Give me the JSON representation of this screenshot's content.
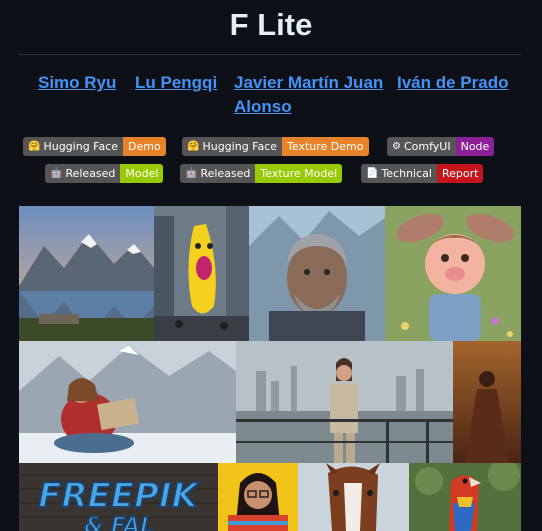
{
  "page": {
    "title": "F Lite"
  },
  "authors": [
    {
      "name": "Simo Ryu"
    },
    {
      "name": "Lu Pengqi"
    },
    {
      "name": "Javier Martín Juan"
    },
    {
      "name": "Iván de Prado"
    },
    {
      "name": "Alonso"
    }
  ],
  "badges": [
    {
      "icon": "🤗",
      "icon_name": "hugging-face-icon",
      "left": "Hugging Face",
      "right": "Demo",
      "color": "#e8832a"
    },
    {
      "icon": "🤗",
      "icon_name": "hugging-face-icon",
      "left": "Hugging Face",
      "right": "Texture Demo",
      "color": "#e8832a"
    },
    {
      "icon": "⚙",
      "icon_name": "gear-icon",
      "left": "ComfyUI",
      "right": "Node",
      "color": "#8a1f96"
    },
    {
      "icon": "🤖",
      "icon_name": "robot-icon",
      "left": "Released",
      "right": "Model",
      "color": "#97ca00"
    },
    {
      "icon": "🤖",
      "icon_name": "robot-icon",
      "left": "Released",
      "right": "Texture Model",
      "color": "#97ca00"
    },
    {
      "icon": "📄",
      "icon_name": "document-icon",
      "left": "Technical",
      "right": "Report",
      "color": "#c6151a"
    }
  ],
  "gallery": {
    "banner_text_1": "FREEPIK",
    "banner_text_2": "& FAL"
  },
  "colors": {
    "background": "#0d1117",
    "link": "#4493f8",
    "badge_left": "#555555"
  }
}
